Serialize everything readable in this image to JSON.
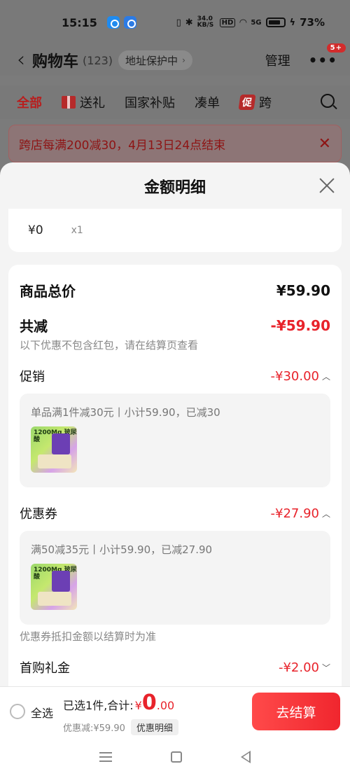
{
  "status_bar": {
    "time": "15:15",
    "net_speed": "34.0 KB/S",
    "hd": "HD",
    "signal": "5G",
    "battery": "73%"
  },
  "header": {
    "title": "购物车",
    "count": "(123)",
    "address": "地址保护中",
    "manage": "管理",
    "badge": "5+"
  },
  "tabs": [
    {
      "label": "全部"
    },
    {
      "label": "送礼"
    },
    {
      "label": "国家补贴"
    },
    {
      "label": "凑单"
    },
    {
      "promo_tag": "促",
      "label": "跨"
    }
  ],
  "banner": {
    "text": "跨店每满200减30，4月13日24点结束"
  },
  "sheet": {
    "title": "金额明细",
    "item": {
      "price": "¥0",
      "qty": "x1"
    },
    "total_label": "商品总价",
    "total_value": "¥59.90",
    "reduce_label": "共减",
    "reduce_value": "-¥59.90",
    "reduce_note": "以下优惠不包含红包，请在结算页查看",
    "promo_label": "促销",
    "promo_value": "-¥30.00",
    "promo_desc": "单品满1件减30元丨小计59.90，已减30",
    "coupon_label": "优惠券",
    "coupon_value": "-¥27.90",
    "coupon_desc": "满50减35元丨小计59.90，已减27.90",
    "coupon_note": "优惠券抵扣金额以结算时为准",
    "firstbuy_label": "首购礼金",
    "firstbuy_value": "-¥2.00",
    "thumb_text": "1200Mg 玻尿酸"
  },
  "bottom": {
    "select_all": "全选",
    "selected": "已选1件,合计:",
    "currency": "¥",
    "amount": "0",
    "decimal": ".00",
    "discount": "优惠减:¥59.90",
    "detail_button": "优惠明细",
    "checkout": "去结算"
  },
  "colors": {
    "accent_red": "#e8232b",
    "overlay": "#7b7b7b"
  }
}
